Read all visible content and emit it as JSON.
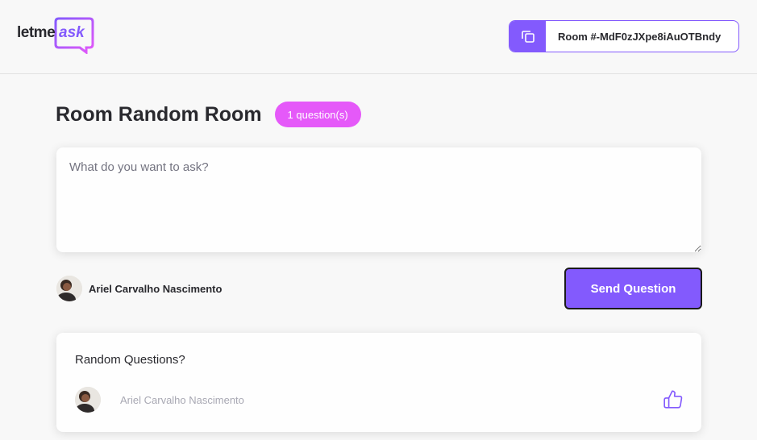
{
  "header": {
    "logo_text_dark": "letme",
    "logo_text_accent": "ask",
    "room_code_label": "Room #-MdF0zJXpe8iAuOTBndy",
    "copy_icon": "copy-icon"
  },
  "main": {
    "room_title": "Room Random Room",
    "question_count_badge": "1 question(s)",
    "ask_placeholder": "What do you want to ask?",
    "user_name": "Ariel Carvalho Nascimento",
    "send_button_label": "Send Question"
  },
  "questions": [
    {
      "content": "Random Questions?",
      "author": "Ariel Carvalho Nascimento",
      "like_icon": "thumbs-up-icon"
    }
  ],
  "colors": {
    "accent_purple": "#835afd",
    "badge_pink": "#e559f9",
    "background": "#f8f8f8",
    "text_dark": "#29292e",
    "text_muted": "#a8a8b3"
  }
}
